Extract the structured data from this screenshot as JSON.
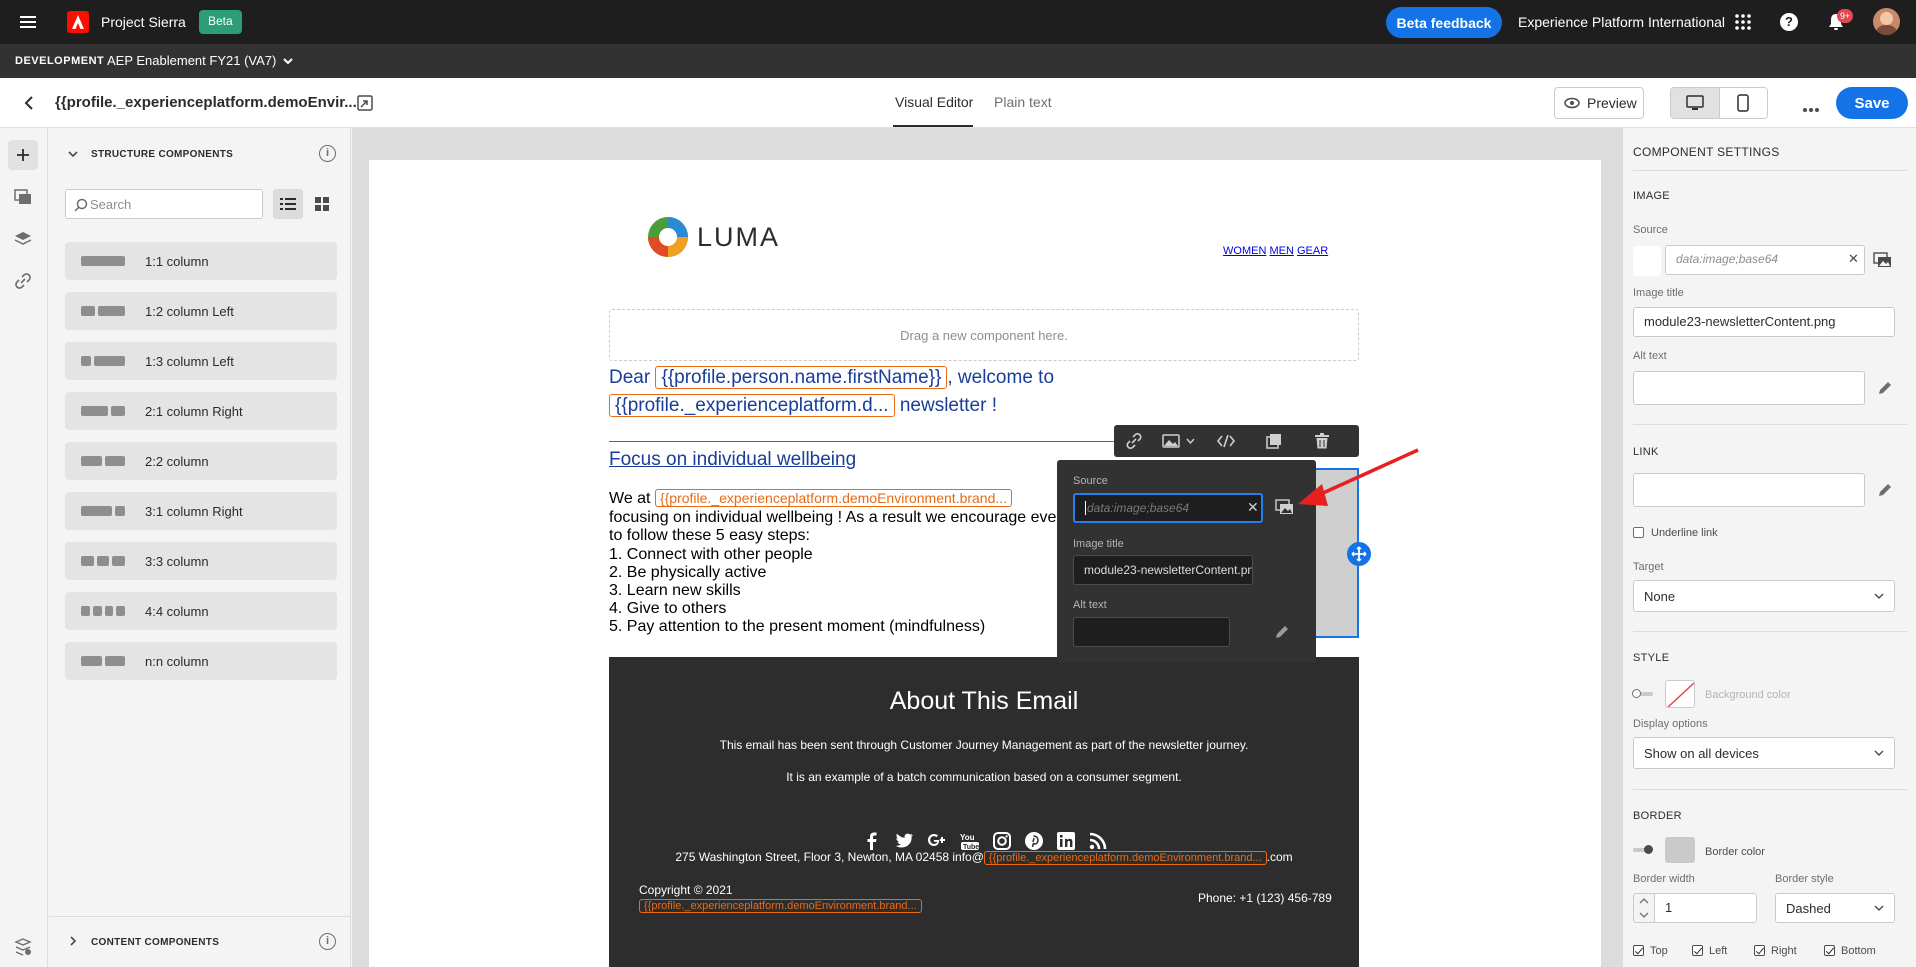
{
  "topbar": {
    "app_name": "Project Sierra",
    "beta_badge": "Beta",
    "beta_feedback": "Beta feedback",
    "org_name": "Experience Platform International",
    "notification_count": "9+"
  },
  "envbar": {
    "environment": "DEVELOPMENT",
    "sandbox": "AEP Enablement FY21 (VA7)"
  },
  "docbar": {
    "title": "{{profile._experienceplatform.demoEnvir...",
    "tabs": [
      "Visual Editor",
      "Plain text"
    ],
    "active_tab": "Visual Editor",
    "preview": "Preview",
    "save": "Save"
  },
  "left_panel": {
    "structure_header": "STRUCTURE COMPONENTS",
    "search_placeholder": "Search",
    "items": [
      {
        "label": "1:1 column",
        "cols": [
          1
        ]
      },
      {
        "label": "1:2 column Left",
        "cols": [
          1,
          2
        ]
      },
      {
        "label": "1:3 column Left",
        "cols": [
          1,
          3
        ]
      },
      {
        "label": "2:1 column Right",
        "cols": [
          2,
          1
        ]
      },
      {
        "label": "2:2 column",
        "cols": [
          1,
          1
        ]
      },
      {
        "label": "3:1 column Right",
        "cols": [
          3,
          1
        ]
      },
      {
        "label": "3:3 column",
        "cols": [
          1,
          1,
          1
        ]
      },
      {
        "label": "4:4 column",
        "cols": [
          1,
          1,
          1,
          1
        ]
      },
      {
        "label": "n:n column",
        "cols": [
          1,
          1
        ]
      }
    ],
    "content_header": "CONTENT COMPONENTS"
  },
  "email": {
    "logo_text": "LUMA",
    "nav": [
      "WOMEN",
      "MEN",
      "GEAR"
    ],
    "drop_hint": "Drag a new component here.",
    "greeting_dear": "Dear",
    "greeting_token1": "{{profile.person.name.firstName}}",
    "greeting_welcome": ", welcome to",
    "greeting_token2": "{{profile._experienceplatform.d...",
    "greeting_newsletter": "newsletter !",
    "headline": "Focus on individual wellbeing",
    "body_we_at": "We at",
    "body_token": "{{profile._experienceplatform.demoEnvironment.brand...",
    "body_line2": "focusing on individual wellbeing ! As a result we encourage eve",
    "body_line3": "to follow these 5 easy steps:",
    "steps": [
      "1. Connect with other people",
      "2. Be physically active",
      "3. Learn new skills",
      "4. Give to others",
      "5. Pay attention to the present moment (mindfulness)"
    ],
    "footer_title": "About This Email",
    "footer_line1": "This email has been sent through Customer Journey Management as part of the newsletter journey.",
    "footer_line2": "It is an example of a batch communication based on a consumer segment.",
    "address_prefix": "275 Washington Street, Floor 3, Newton, MA 02458 info@",
    "address_token": "{{profile._experienceplatform.demoEnvironment.brand...",
    "address_suffix": ".com",
    "copyright": "Copyright © 2021",
    "copyright_token": "{{profile._experienceplatform.demoEnvironment.brand...",
    "phone": "Phone: +1 (123) 456-789"
  },
  "popover": {
    "source_label": "Source",
    "source_placeholder": "data:image;base64",
    "image_title_label": "Image title",
    "image_title_value": "module23-newsletterContent.png",
    "alt_text_label": "Alt text"
  },
  "right_panel": {
    "header": "COMPONENT SETTINGS",
    "image_section": "IMAGE",
    "source_label": "Source",
    "source_placeholder": "data:image;base64",
    "image_title_label": "Image title",
    "image_title_value": "module23-newsletterContent.png",
    "alt_text_label": "Alt text",
    "link_section": "LINK",
    "underline_label": "Underline link",
    "target_label": "Target",
    "target_value": "None",
    "style_section": "STYLE",
    "bg_color_label": "Background color",
    "display_label": "Display options",
    "display_value": "Show on all devices",
    "border_section": "BORDER",
    "border_color_label": "Border color",
    "border_width_label": "Border width",
    "border_width_value": "1",
    "border_style_label": "Border style",
    "border_style_value": "Dashed",
    "sides": [
      "Top",
      "Left",
      "Right",
      "Bottom"
    ]
  },
  "colors": {
    "accent_blue": "#1473e6",
    "token_orange": "#e86b16",
    "beta_green": "#2d9d78",
    "adobe_red": "#fa0f00",
    "annotation_red": "#e82020"
  }
}
